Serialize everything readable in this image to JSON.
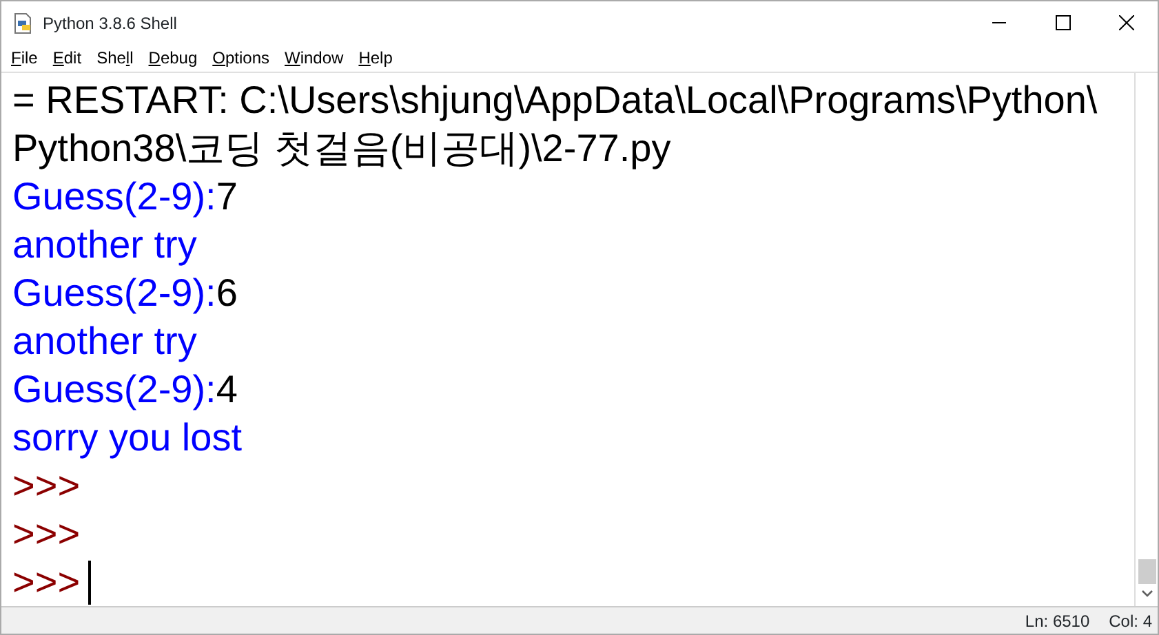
{
  "window": {
    "title": "Python 3.8.6 Shell"
  },
  "menu": [
    {
      "parts": [
        {
          "text": "F",
          "underlined": true
        },
        {
          "text": "ile",
          "underlined": false
        }
      ]
    },
    {
      "parts": [
        {
          "text": "E",
          "underlined": true
        },
        {
          "text": "dit",
          "underlined": false
        }
      ]
    },
    {
      "parts": [
        {
          "text": "She",
          "underlined": false
        },
        {
          "text": "l",
          "underlined": true
        },
        {
          "text": "l",
          "underlined": false
        }
      ]
    },
    {
      "parts": [
        {
          "text": "D",
          "underlined": true
        },
        {
          "text": "ebug",
          "underlined": false
        }
      ]
    },
    {
      "parts": [
        {
          "text": "O",
          "underlined": true
        },
        {
          "text": "ptions",
          "underlined": false
        }
      ]
    },
    {
      "parts": [
        {
          "text": "W",
          "underlined": true
        },
        {
          "text": "indow",
          "underlined": false
        }
      ]
    },
    {
      "parts": [
        {
          "text": "H",
          "underlined": true
        },
        {
          "text": "elp",
          "underlined": false
        }
      ]
    }
  ],
  "lines": [
    {
      "segments": [
        {
          "kind": "stdout",
          "text": "= RESTART: C:\\Users\\shjung\\AppData\\Local\\Programs\\Python\\"
        }
      ]
    },
    {
      "segments": [
        {
          "kind": "stdout",
          "text": "Python38\\코딩 첫걸음(비공대)\\2-77.py"
        }
      ]
    },
    {
      "segments": [
        {
          "kind": "output",
          "text": "Guess(2-9):"
        },
        {
          "kind": "input",
          "text": "7"
        }
      ]
    },
    {
      "segments": [
        {
          "kind": "output",
          "text": "another try"
        }
      ]
    },
    {
      "segments": [
        {
          "kind": "output",
          "text": "Guess(2-9):"
        },
        {
          "kind": "input",
          "text": "6"
        }
      ]
    },
    {
      "segments": [
        {
          "kind": "output",
          "text": "another try"
        }
      ]
    },
    {
      "segments": [
        {
          "kind": "output",
          "text": "Guess(2-9):"
        },
        {
          "kind": "input",
          "text": "4"
        }
      ]
    },
    {
      "segments": [
        {
          "kind": "output",
          "text": "sorry you lost"
        }
      ]
    },
    {
      "segments": [
        {
          "kind": "prompt",
          "text": ">>>"
        }
      ]
    },
    {
      "segments": [
        {
          "kind": "prompt",
          "text": ">>>"
        }
      ]
    },
    {
      "segments": [
        {
          "kind": "prompt",
          "text": ">>>"
        }
      ],
      "cursor": true
    }
  ],
  "status_bar": {
    "line": "Ln: 6510",
    "column": "Col: 4"
  }
}
